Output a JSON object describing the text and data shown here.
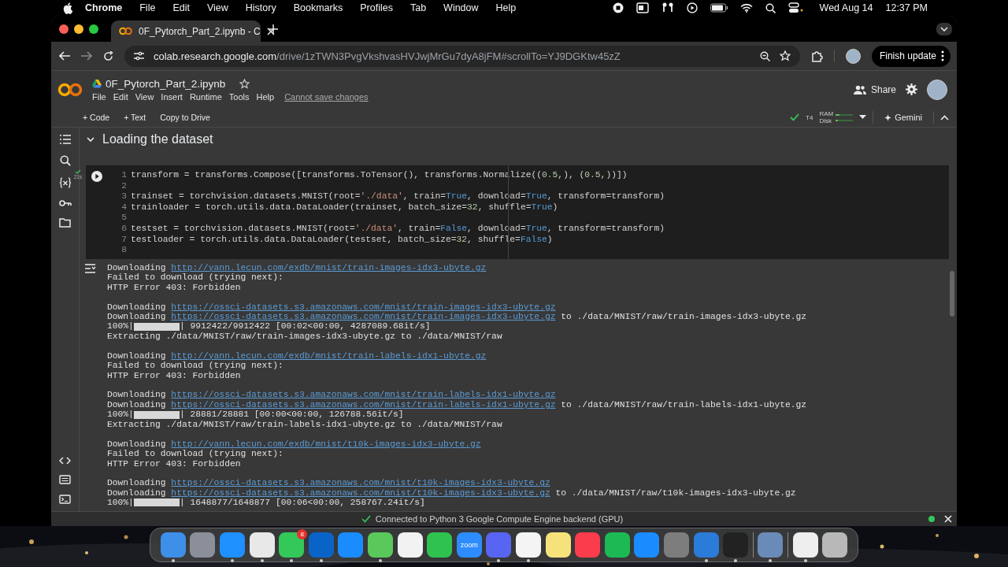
{
  "menu_bar": {
    "app": "Chrome",
    "menus": [
      "File",
      "Edit",
      "View",
      "History",
      "Bookmarks",
      "Profiles",
      "Tab",
      "Window",
      "Help"
    ],
    "date": "Wed Aug 14",
    "time": "12:37 PM"
  },
  "browser": {
    "tabs": [
      {
        "title": "0F_Pytorch_Part_2.ipynb - C",
        "selected": true
      }
    ],
    "host": "colab.research.google.com",
    "path": "/drive/1zTWN3PvgVkshvasHVJwjMrGu7dyA8jFM#scrollTo=YJ9DGKtw45zZ",
    "update_button": "Finish update"
  },
  "notebook": {
    "title": "0F_Pytorch_Part_2.ipynb",
    "menus": [
      "File",
      "Edit",
      "View",
      "Insert",
      "Runtime",
      "Tools",
      "Help"
    ],
    "save_notice": "Cannot save changes",
    "share": "Share"
  },
  "toolbar": {
    "actions": [
      "+ Code",
      "+ Text",
      "Copy to Drive"
    ],
    "connected": true,
    "gpu": "T4",
    "ram": "RAM",
    "disk": "Disk",
    "gemini": "Gemini"
  },
  "section": {
    "title": "Loading the dataset",
    "expanded": true
  },
  "cell": {
    "duration": "21s",
    "lines": [
      {
        "number": "1",
        "tokens": [
          {
            "kind": "plain",
            "text": "transform = transforms.Compose([transforms.ToTensor(), transforms.Normalize(("
          },
          {
            "kind": "number",
            "text": "0.5"
          },
          {
            "kind": "plain",
            "text": ",), ("
          },
          {
            "kind": "number",
            "text": "0.5"
          },
          {
            "kind": "plain",
            "text": ",))])"
          }
        ]
      },
      {
        "number": "2"
      },
      {
        "number": "3",
        "tokens": [
          {
            "kind": "plain",
            "text": "trainset = torchvision.datasets.MNIST(root="
          },
          {
            "kind": "string",
            "text": "'./data'"
          },
          {
            "kind": "plain",
            "text": ", train="
          },
          {
            "kind": "keyword",
            "text": "True"
          },
          {
            "kind": "plain",
            "text": ", download="
          },
          {
            "kind": "keyword",
            "text": "True"
          },
          {
            "kind": "plain",
            "text": ", transform=transform)"
          }
        ]
      },
      {
        "number": "4",
        "tokens": [
          {
            "kind": "plain",
            "text": "trainloader = torch.utils.data.DataLoader(trainset, batch_size="
          },
          {
            "kind": "number",
            "text": "32"
          },
          {
            "kind": "plain",
            "text": ", shuffle="
          },
          {
            "kind": "keyword",
            "text": "True"
          },
          {
            "kind": "plain",
            "text": ")"
          }
        ]
      },
      {
        "number": "5"
      },
      {
        "number": "6",
        "tokens": [
          {
            "kind": "plain",
            "text": "testset = torchvision.datasets.MNIST(root="
          },
          {
            "kind": "string",
            "text": "'./data'"
          },
          {
            "kind": "plain",
            "text": ", train="
          },
          {
            "kind": "keyword",
            "text": "False"
          },
          {
            "kind": "plain",
            "text": ", download="
          },
          {
            "kind": "keyword",
            "text": "True"
          },
          {
            "kind": "plain",
            "text": ", transform=transform)"
          }
        ]
      },
      {
        "number": "7",
        "tokens": [
          {
            "kind": "plain",
            "text": "testloader = torch.utils.data.DataLoader(testset, batch_size="
          },
          {
            "kind": "number",
            "text": "32"
          },
          {
            "kind": "plain",
            "text": ", shuffle="
          },
          {
            "kind": "keyword",
            "text": "False"
          },
          {
            "kind": "plain",
            "text": ")"
          }
        ]
      },
      {
        "number": "8"
      }
    ]
  },
  "output": {
    "lines": [
      {
        "kind": "link",
        "text": "Downloading ",
        "link": "http://yann.lecun.com/exdb/mnist/train-images-idx3-ubyte.gz"
      },
      {
        "kind": "text",
        "text": "Failed to download (trying next):"
      },
      {
        "kind": "text",
        "text": "HTTP Error 403: Forbidden"
      },
      {
        "kind": "blank"
      },
      {
        "kind": "link",
        "text": "Downloading ",
        "link": "https://ossci-datasets.s3.amazonaws.com/mnist/train-images-idx3-ubyte.gz"
      },
      {
        "kind": "link",
        "text": "Downloading ",
        "link": "https://ossci-datasets.s3.amazonaws.com/mnist/train-images-idx3-ubyte.gz",
        "suffix": " to ./data/MNIST/raw/train-images-idx3-ubyte.gz"
      },
      {
        "kind": "progress",
        "text": "100%|",
        "level": 1,
        "suffix": "| 9912422/9912422 [00:02<00:00, 4287089.68it/s]"
      },
      {
        "kind": "text",
        "text": "Extracting ./data/MNIST/raw/train-images-idx3-ubyte.gz to ./data/MNIST/raw"
      },
      {
        "kind": "blank"
      },
      {
        "kind": "link",
        "text": "Downloading ",
        "link": "http://yann.lecun.com/exdb/mnist/train-labels-idx1-ubyte.gz"
      },
      {
        "kind": "text",
        "text": "Failed to download (trying next):"
      },
      {
        "kind": "text",
        "text": "HTTP Error 403: Forbidden"
      },
      {
        "kind": "blank"
      },
      {
        "kind": "link",
        "text": "Downloading ",
        "link": "https://ossci-datasets.s3.amazonaws.com/mnist/train-labels-idx1-ubyte.gz"
      },
      {
        "kind": "link",
        "text": "Downloading ",
        "link": "https://ossci-datasets.s3.amazonaws.com/mnist/train-labels-idx1-ubyte.gz",
        "suffix": " to ./data/MNIST/raw/train-labels-idx1-ubyte.gz"
      },
      {
        "kind": "progress",
        "text": "100%|",
        "level": 1,
        "suffix": "| 28881/28881 [00:00<00:00, 126788.56it/s]"
      },
      {
        "kind": "text",
        "text": "Extracting ./data/MNIST/raw/train-labels-idx1-ubyte.gz to ./data/MNIST/raw"
      },
      {
        "kind": "blank"
      },
      {
        "kind": "link",
        "text": "Downloading ",
        "link": "http://yann.lecun.com/exdb/mnist/t10k-images-idx3-ubyte.gz"
      },
      {
        "kind": "text",
        "text": "Failed to download (trying next):"
      },
      {
        "kind": "text",
        "text": "HTTP Error 403: Forbidden"
      },
      {
        "kind": "blank"
      },
      {
        "kind": "link",
        "text": "Downloading ",
        "link": "https://ossci-datasets.s3.amazonaws.com/mnist/t10k-images-idx3-ubyte.gz"
      },
      {
        "kind": "link",
        "text": "Downloading ",
        "link": "https://ossci-datasets.s3.amazonaws.com/mnist/t10k-images-idx3-ubyte.gz",
        "suffix": " to ./data/MNIST/raw/t10k-images-idx3-ubyte.gz"
      },
      {
        "kind": "progress",
        "text": "100%|",
        "level": 1,
        "suffix": "| 1648877/1648877 [00:06<00:00, 258767.24it/s]"
      }
    ]
  },
  "status_bar": {
    "message": "Connected to Python 3 Google Compute Engine backend (GPU)"
  },
  "dock": {
    "items": [
      {
        "kind": "app",
        "color": "#3d8fe8",
        "running": true
      },
      {
        "kind": "app",
        "color": "#8a8f99",
        "running": false
      },
      {
        "kind": "app",
        "color": "#1e90ff",
        "running": true
      },
      {
        "kind": "app",
        "color": "#e8e8e8",
        "running": true
      },
      {
        "kind": "app",
        "color": "#34c759",
        "running": true,
        "badge": "8"
      },
      {
        "kind": "app",
        "color": "#0a64c8",
        "running": true
      },
      {
        "kind": "app",
        "color": "#1a8cff",
        "running": false
      },
      {
        "kind": "app",
        "color": "#5ac85a",
        "running": true
      },
      {
        "kind": "app",
        "color": "#f2f2f2",
        "running": false
      },
      {
        "kind": "app",
        "color": "#2fc24f",
        "running": false
      },
      {
        "kind": "app",
        "color": "#2d8cff",
        "running": false,
        "label": "zoom"
      },
      {
        "kind": "app",
        "color": "#5865f2",
        "running": true
      },
      {
        "kind": "app",
        "color": "#f4f4f4",
        "running": true
      },
      {
        "kind": "app",
        "color": "#f6e27a",
        "running": false
      },
      {
        "kind": "app",
        "color": "#fa3c4c",
        "running": false
      },
      {
        "kind": "app",
        "color": "#1db954",
        "running": false
      },
      {
        "kind": "app",
        "color": "#1a8cff",
        "running": false
      },
      {
        "kind": "app",
        "color": "#7d7d7d",
        "running": false
      },
      {
        "kind": "app",
        "color": "#2b7bd8",
        "running": true
      },
      {
        "kind": "app",
        "color": "#222222",
        "running": true
      },
      {
        "kind": "separator"
      },
      {
        "kind": "app",
        "color": "#6a8bb8",
        "running": true
      },
      {
        "kind": "separator"
      },
      {
        "kind": "app",
        "color": "#eeeeee",
        "running": true
      },
      {
        "kind": "app",
        "color": "#b8b8b8",
        "running": false
      }
    ]
  }
}
